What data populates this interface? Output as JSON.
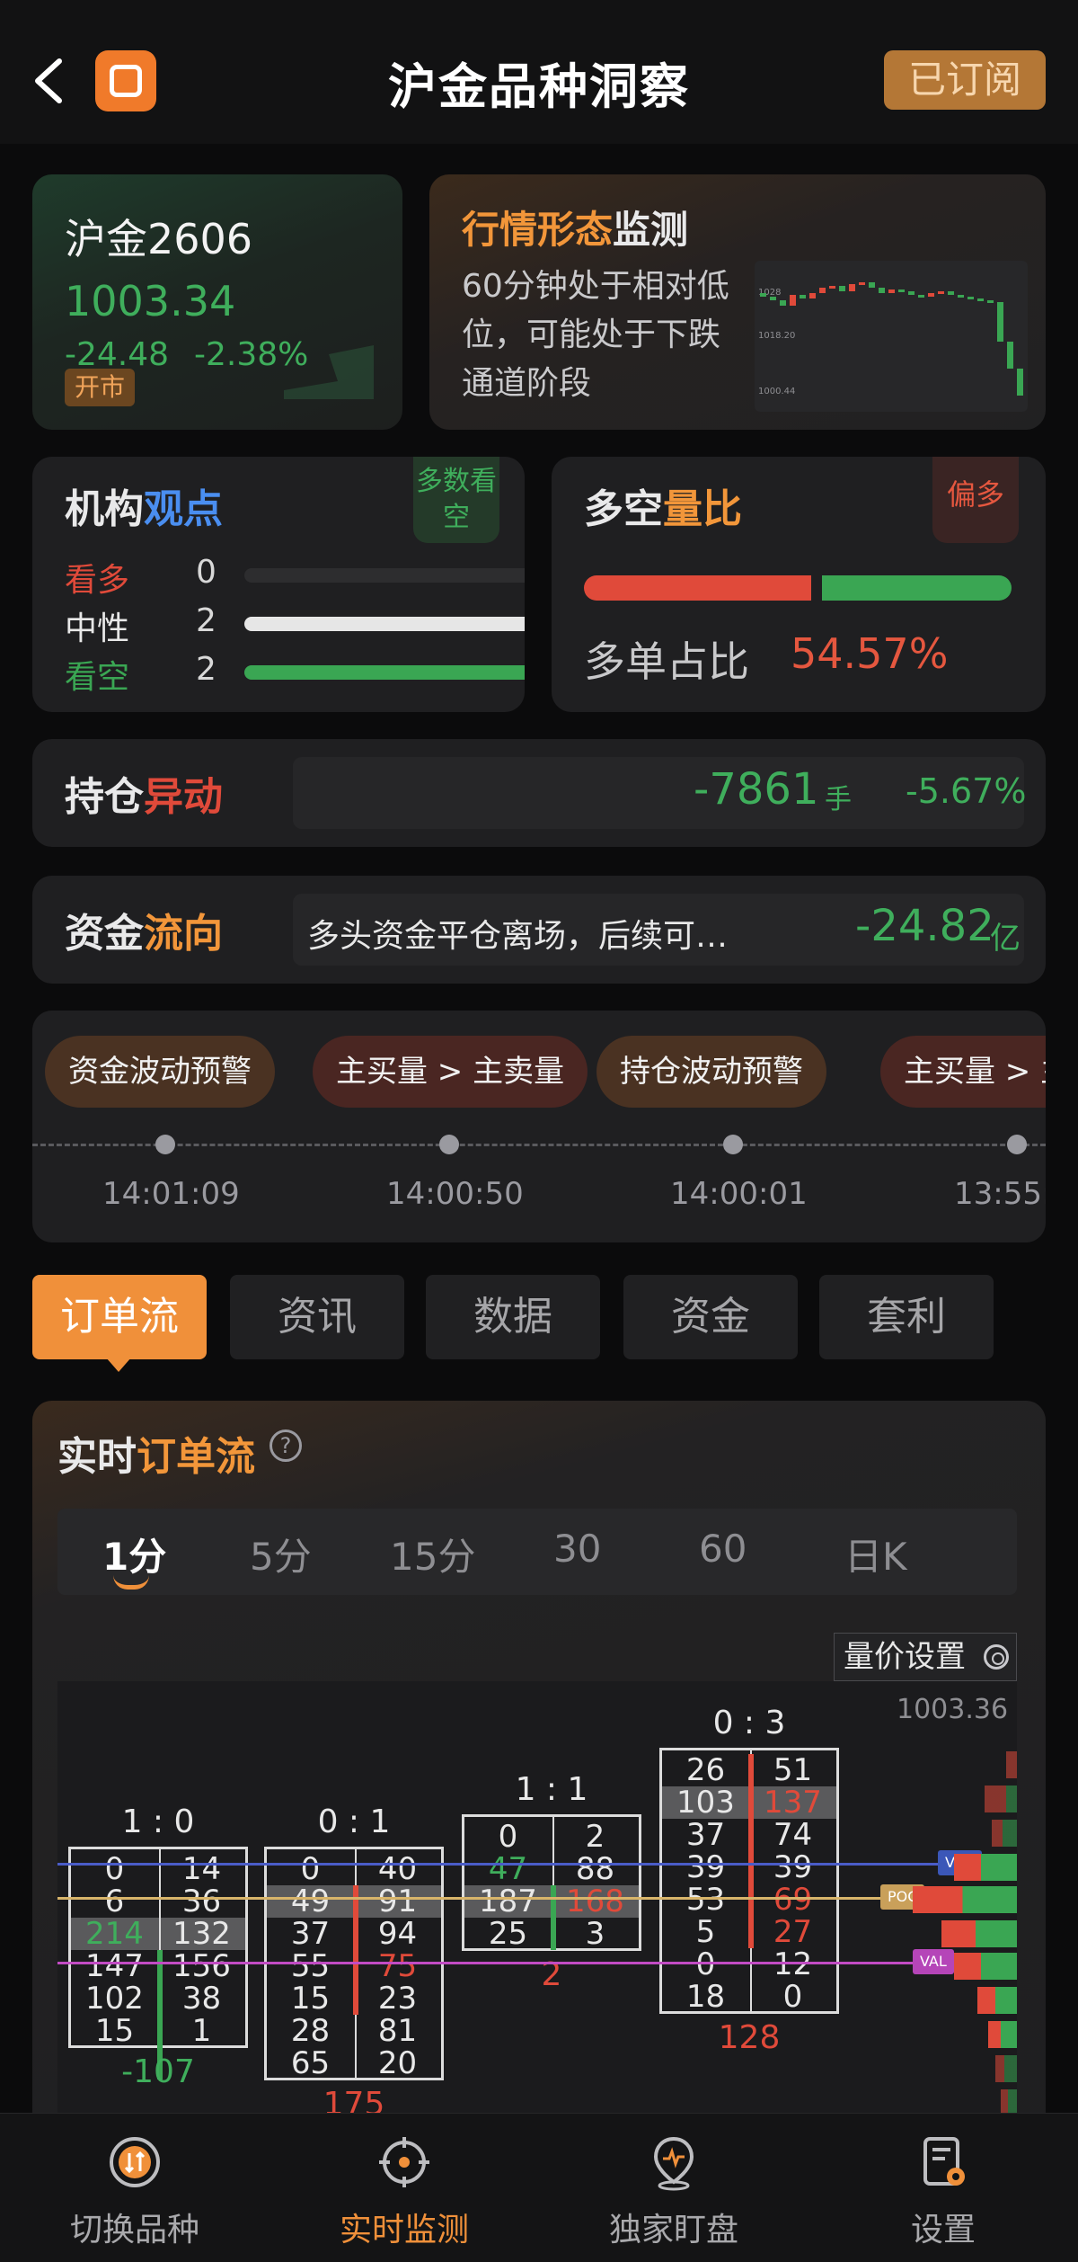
{
  "header": {
    "title": "沪金品种洞察",
    "subscribe_label": "已订阅"
  },
  "quote": {
    "name": "沪金2606",
    "price": "1003.34",
    "change": "-24.48",
    "change_pct": "-2.38%",
    "status": "开市"
  },
  "pattern": {
    "title_hl": "行情形态",
    "title_rest": "监测",
    "desc": "60分钟处于相对低位，可能处于下跌通道阶段",
    "mini_labels": [
      "1028",
      "1018.20",
      "1000.44"
    ]
  },
  "views": {
    "title_a": "机构",
    "title_b": "观点",
    "tag": "多数看空",
    "rows": [
      {
        "label": "看多",
        "count": "0",
        "fill": 0.0,
        "color": "#e04a3a"
      },
      {
        "label": "中性",
        "count": "2",
        "fill": 1.0,
        "color": "#e6e6e6"
      },
      {
        "label": "看空",
        "count": "2",
        "fill": 1.0,
        "color": "#3aa653"
      }
    ]
  },
  "ls_ratio": {
    "title_a": "多空",
    "title_b": "量比",
    "tag": "偏多",
    "label": "多单占比",
    "value": "54.57%",
    "long_fraction": 0.5457
  },
  "oi": {
    "title_a": "持仓",
    "title_b": "异动",
    "value": "-7861",
    "unit": "手",
    "pct": "-5.67%"
  },
  "flow": {
    "title_a": "资金",
    "title_b": "流向",
    "desc": "多头资金平仓离场，后续可…",
    "value": "-24.82",
    "unit": "亿"
  },
  "alerts": [
    {
      "label": "资金波动预警",
      "time": "14:01:09",
      "tone": "brown"
    },
    {
      "label": "主买量 > 主卖量",
      "time": "14:00:50",
      "tone": "red"
    },
    {
      "label": "持仓波动预警",
      "time": "14:00:01",
      "tone": "brown"
    },
    {
      "label": "主买量 > 主",
      "time": "13:55:",
      "tone": "red"
    }
  ],
  "tabs": [
    "订单流",
    "资讯",
    "数据",
    "资金",
    "套利"
  ],
  "orderflow": {
    "title_a": "实时",
    "title_b": "订单流",
    "help": "?",
    "periods": [
      "1分",
      "5分",
      "15分",
      "30",
      "60",
      "日K"
    ],
    "settings_label": "量价设置",
    "top_price": "1003.36",
    "levels": {
      "vah": "VAH",
      "poc": "POC",
      "val": "VAL"
    },
    "bars": [
      {
        "ratio": "1 : 0",
        "delta": "-107",
        "delta_color": "green",
        "rows": [
          [
            "0",
            "14"
          ],
          [
            "6",
            "36"
          ],
          [
            "214",
            "132"
          ],
          [
            "147",
            "156"
          ],
          [
            "102",
            "38"
          ],
          [
            "15",
            "1"
          ]
        ]
      },
      {
        "ratio": "0 : 1",
        "delta": "175",
        "delta_color": "red",
        "rows": [
          [
            "0",
            "40"
          ],
          [
            "49",
            "91"
          ],
          [
            "37",
            "94"
          ],
          [
            "55",
            "75"
          ],
          [
            "15",
            "23"
          ],
          [
            "28",
            "81"
          ],
          [
            "65",
            "20"
          ]
        ]
      },
      {
        "ratio": "1 : 1",
        "delta": "2",
        "delta_color": "red",
        "rows": [
          [
            "0",
            "2"
          ],
          [
            "47",
            "88"
          ],
          [
            "187",
            "168"
          ],
          [
            "25",
            "3"
          ]
        ]
      },
      {
        "ratio": "0 : 3",
        "delta": "128",
        "delta_color": "red",
        "rows": [
          [
            "26",
            "51"
          ],
          [
            "103",
            "137"
          ],
          [
            "37",
            "74"
          ],
          [
            "39",
            "39"
          ],
          [
            "53",
            "69"
          ],
          [
            "5",
            "27"
          ],
          [
            "0",
            "12"
          ],
          [
            "18",
            "0"
          ]
        ]
      }
    ]
  },
  "nav": [
    "切换品种",
    "实时监测",
    "独家盯盘",
    "设置"
  ],
  "colors": {
    "accent": "#f0903a",
    "up": "#e04a3a",
    "down": "#3fae5c"
  }
}
